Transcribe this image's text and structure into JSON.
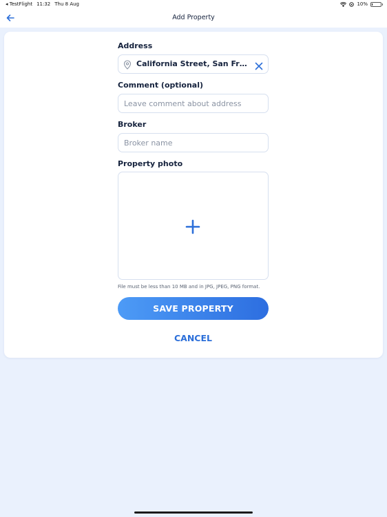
{
  "status_bar": {
    "back_app": "◂ TestFlight",
    "time": "11:32",
    "date": "Thu 8 Aug",
    "battery": "10%",
    "battery_level": 0.1
  },
  "nav": {
    "title": "Add Property",
    "back_icon": "arrow-left-icon"
  },
  "form": {
    "address": {
      "label": "Address",
      "value": "California Street, San Francisco",
      "icon": "map-pin-icon",
      "clear_icon": "close-icon"
    },
    "comment": {
      "label": "Comment (optional)",
      "placeholder": "Leave comment about address",
      "value": ""
    },
    "broker": {
      "label": "Broker",
      "placeholder": "Broker name",
      "value": ""
    },
    "photo": {
      "label": "Property photo",
      "icon": "plus-icon",
      "hint": "File must be less than 10 MB and in JPG, JPEG, PNG format."
    },
    "save_label": "SAVE PROPERTY",
    "cancel_label": "CANCEL"
  },
  "colors": {
    "accent": "#2c6fd9",
    "background": "#eaf1fd",
    "text": "#15223d"
  }
}
